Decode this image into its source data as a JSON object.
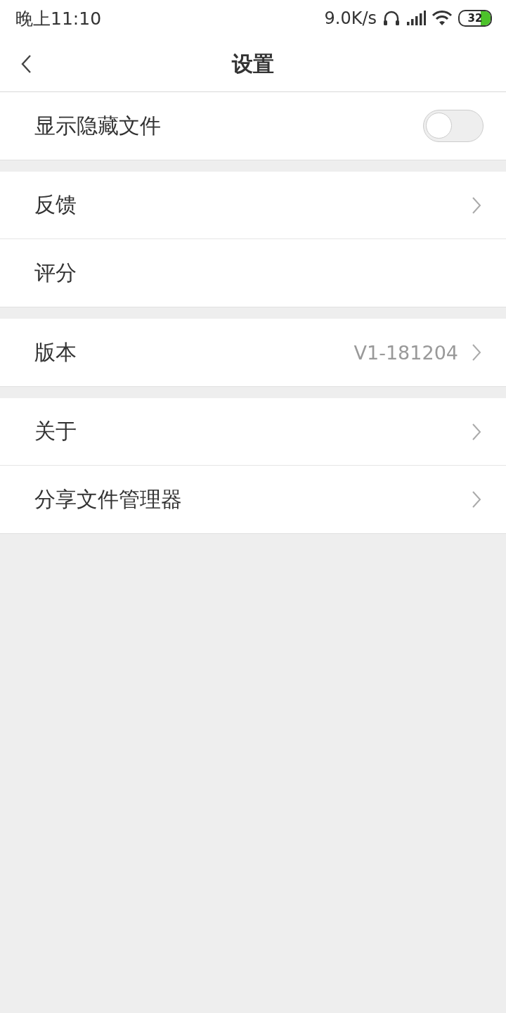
{
  "status_bar": {
    "time": "晚上11:10",
    "speed": "9.0K/s",
    "battery": "32"
  },
  "header": {
    "title": "设置"
  },
  "groups": [
    {
      "items": [
        {
          "kind": "toggle",
          "label": "显示隐藏文件",
          "on": false
        }
      ]
    },
    {
      "items": [
        {
          "kind": "nav",
          "label": "反馈"
        },
        {
          "kind": "plain",
          "label": "评分"
        }
      ]
    },
    {
      "items": [
        {
          "kind": "nav",
          "label": "版本",
          "value": "V1-181204"
        }
      ]
    },
    {
      "items": [
        {
          "kind": "nav",
          "label": "关于"
        },
        {
          "kind": "nav",
          "label": "分享文件管理器"
        }
      ]
    }
  ]
}
